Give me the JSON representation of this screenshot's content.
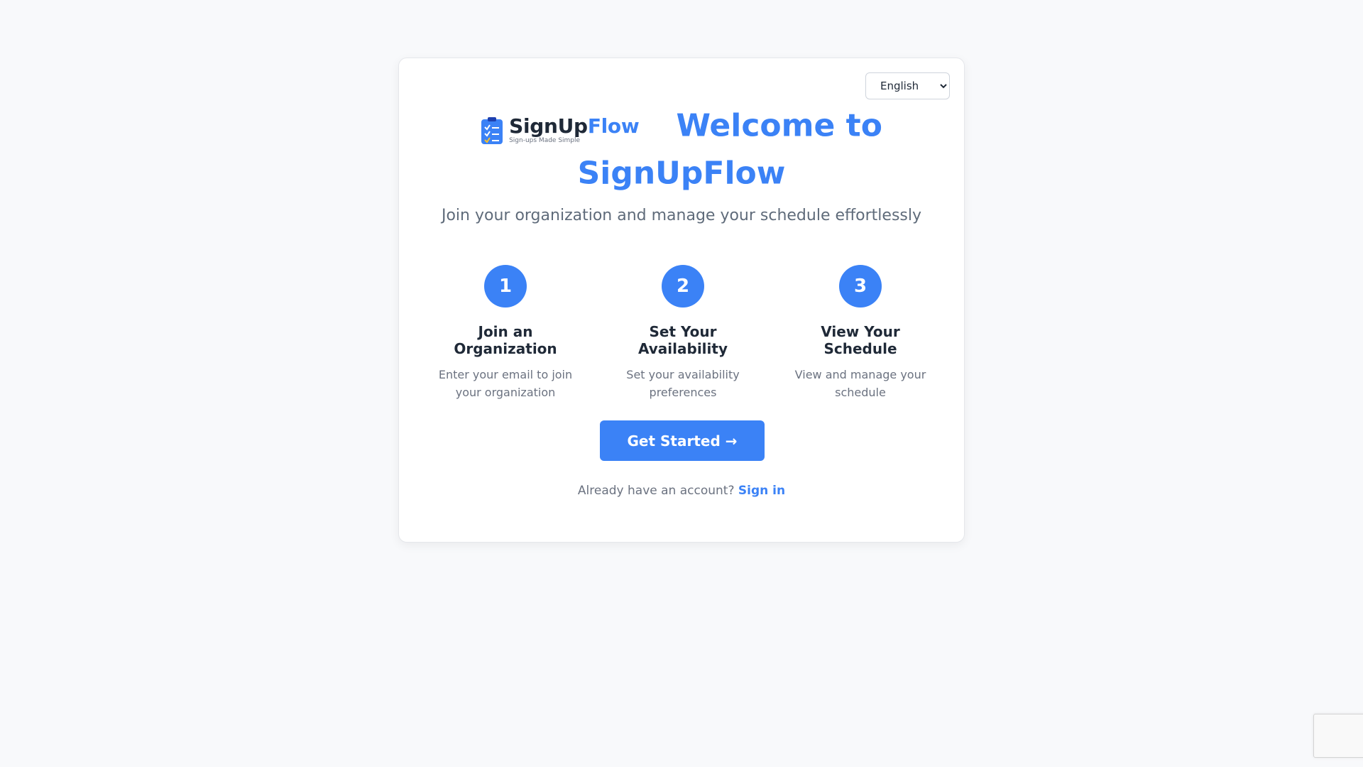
{
  "language": {
    "selected": "English",
    "options": [
      "English"
    ]
  },
  "brand": {
    "name_primary": "SignUp",
    "name_accent": "Flow",
    "tagline": "Sign-ups Made Simple"
  },
  "hero": {
    "title": "Welcome to SignUpFlow",
    "subtitle": "Join your organization and manage your schedule effortlessly"
  },
  "steps": [
    {
      "number": "1",
      "title": "Join an Organization",
      "description": "Enter your email to join your organization"
    },
    {
      "number": "2",
      "title": "Set Your Availability",
      "description": "Set your availability preferences"
    },
    {
      "number": "3",
      "title": "View Your Schedule",
      "description": "View and manage your schedule"
    }
  ],
  "cta": {
    "label": "Get Started →"
  },
  "signin": {
    "prompt": "Already have an account?",
    "link_label": "Sign in"
  },
  "colors": {
    "accent": "#3b82f6",
    "background": "#f8f9fb",
    "text": "#1f2937",
    "muted": "#6b7280"
  }
}
